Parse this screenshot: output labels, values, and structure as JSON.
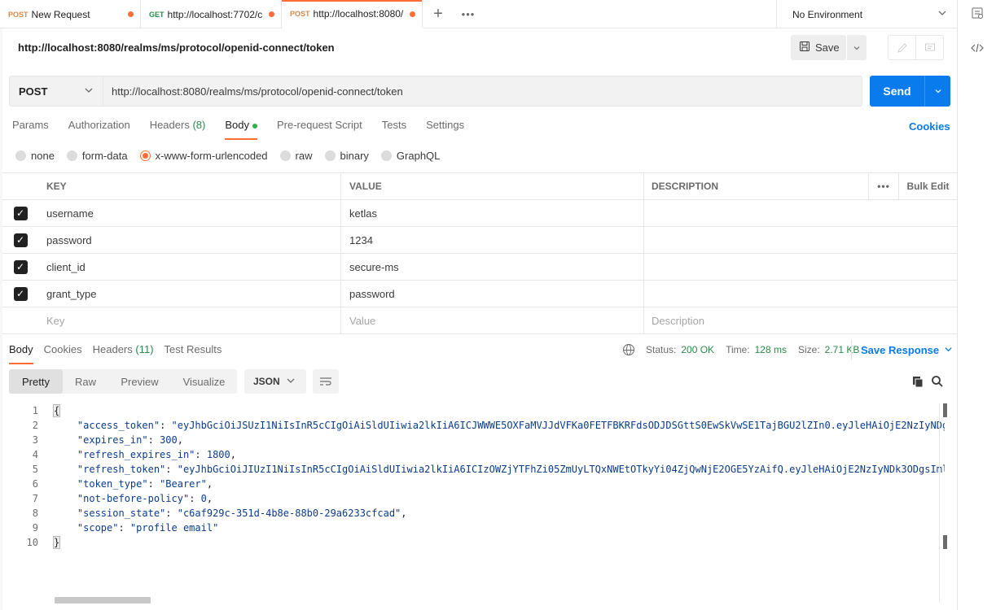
{
  "tabs": [
    {
      "method": "POST",
      "title": "New Request",
      "active": false
    },
    {
      "method": "GET",
      "title": "http://localhost:7702/c",
      "active": false
    },
    {
      "method": "POST",
      "title": "http://localhost:8080/",
      "active": true
    }
  ],
  "environment": "No Environment",
  "request": {
    "name": "http://localhost:8080/realms/ms/protocol/openid-connect/token",
    "save_label": "Save",
    "method": "POST",
    "url": "http://localhost:8080/realms/ms/protocol/openid-connect/token",
    "send_label": "Send"
  },
  "request_tabs": {
    "params": "Params",
    "authorization": "Authorization",
    "headers": "Headers",
    "headers_count": "(8)",
    "body": "Body",
    "prerequest": "Pre-request Script",
    "tests": "Tests",
    "settings": "Settings",
    "cookies": "Cookies"
  },
  "body_types": {
    "none": "none",
    "form_data": "form-data",
    "urlencoded": "x-www-form-urlencoded",
    "raw": "raw",
    "binary": "binary",
    "graphql": "GraphQL"
  },
  "params_table": {
    "headers": {
      "key": "KEY",
      "value": "VALUE",
      "description": "DESCRIPTION",
      "bulk_edit": "Bulk Edit"
    },
    "rows": [
      {
        "key": "username",
        "value": "ketlas"
      },
      {
        "key": "password",
        "value": "1234"
      },
      {
        "key": "client_id",
        "value": "secure-ms"
      },
      {
        "key": "grant_type",
        "value": "password"
      }
    ],
    "placeholders": {
      "key": "Key",
      "value": "Value",
      "description": "Description"
    }
  },
  "response": {
    "tabs": {
      "body": "Body",
      "cookies": "Cookies",
      "headers": "Headers",
      "headers_count": "(11)",
      "test_results": "Test Results"
    },
    "status_label": "Status:",
    "status_value": "200 OK",
    "time_label": "Time:",
    "time_value": "128 ms",
    "size_label": "Size:",
    "size_value": "2.71 KB",
    "save_response": "Save Response",
    "views": {
      "pretty": "Pretty",
      "raw": "Raw",
      "preview": "Preview",
      "visualize": "Visualize"
    },
    "format": "JSON"
  },
  "json_body": {
    "line1": "{",
    "access_token_key": "\"access_token\"",
    "access_token_val": "\"eyJhbGciOiJSUzI1NiIsInR5cCIgOiAiSldUIiwia2lkIiA6ICJWWWE5OXFaMVJJdVFKa0FETFBKRFdsODJDSGttS0EwSkVwSE1TajBGU2lZIn0.eyJleHAiOjE2NzIyNDgyMzQsImlhdCI6MTY3MjI0NzkzNCwianRpIjoiM\"",
    "expires_in_key": "\"expires_in\"",
    "expires_in_val": "300",
    "refresh_expires_in_key": "\"refresh_expires_in\"",
    "refresh_expires_in_val": "1800",
    "refresh_token_key": "\"refresh_token\"",
    "refresh_token_val": "\"eyJhbGciOiJIUzI1NiIsInR5cCIgOiAiSldUIiwia2lkIiA6ICIzOWZjYTFhZi05ZmUyLTQxNWEtOTkyYi04ZjQwNjE2OGE5YzAifQ.eyJleHAiOjE2NzIyNDk3ODgsImlhdCI6MTY3MjI0NzkzNCwianRpIjoiZ\"",
    "token_type_key": "\"token_type\"",
    "token_type_val": "\"Bearer\"",
    "not_before_key": "\"not-before-policy\"",
    "not_before_val": "0",
    "session_state_key": "\"session_state\"",
    "session_state_val": "\"c6af929c-351d-4b8e-88b0-29a6233cfcad\"",
    "scope_key": "\"scope\"",
    "scope_val": "\"profile email\"",
    "line10": "}"
  },
  "line_numbers": [
    "1",
    "2",
    "3",
    "4",
    "5",
    "6",
    "7",
    "8",
    "9",
    "10"
  ]
}
